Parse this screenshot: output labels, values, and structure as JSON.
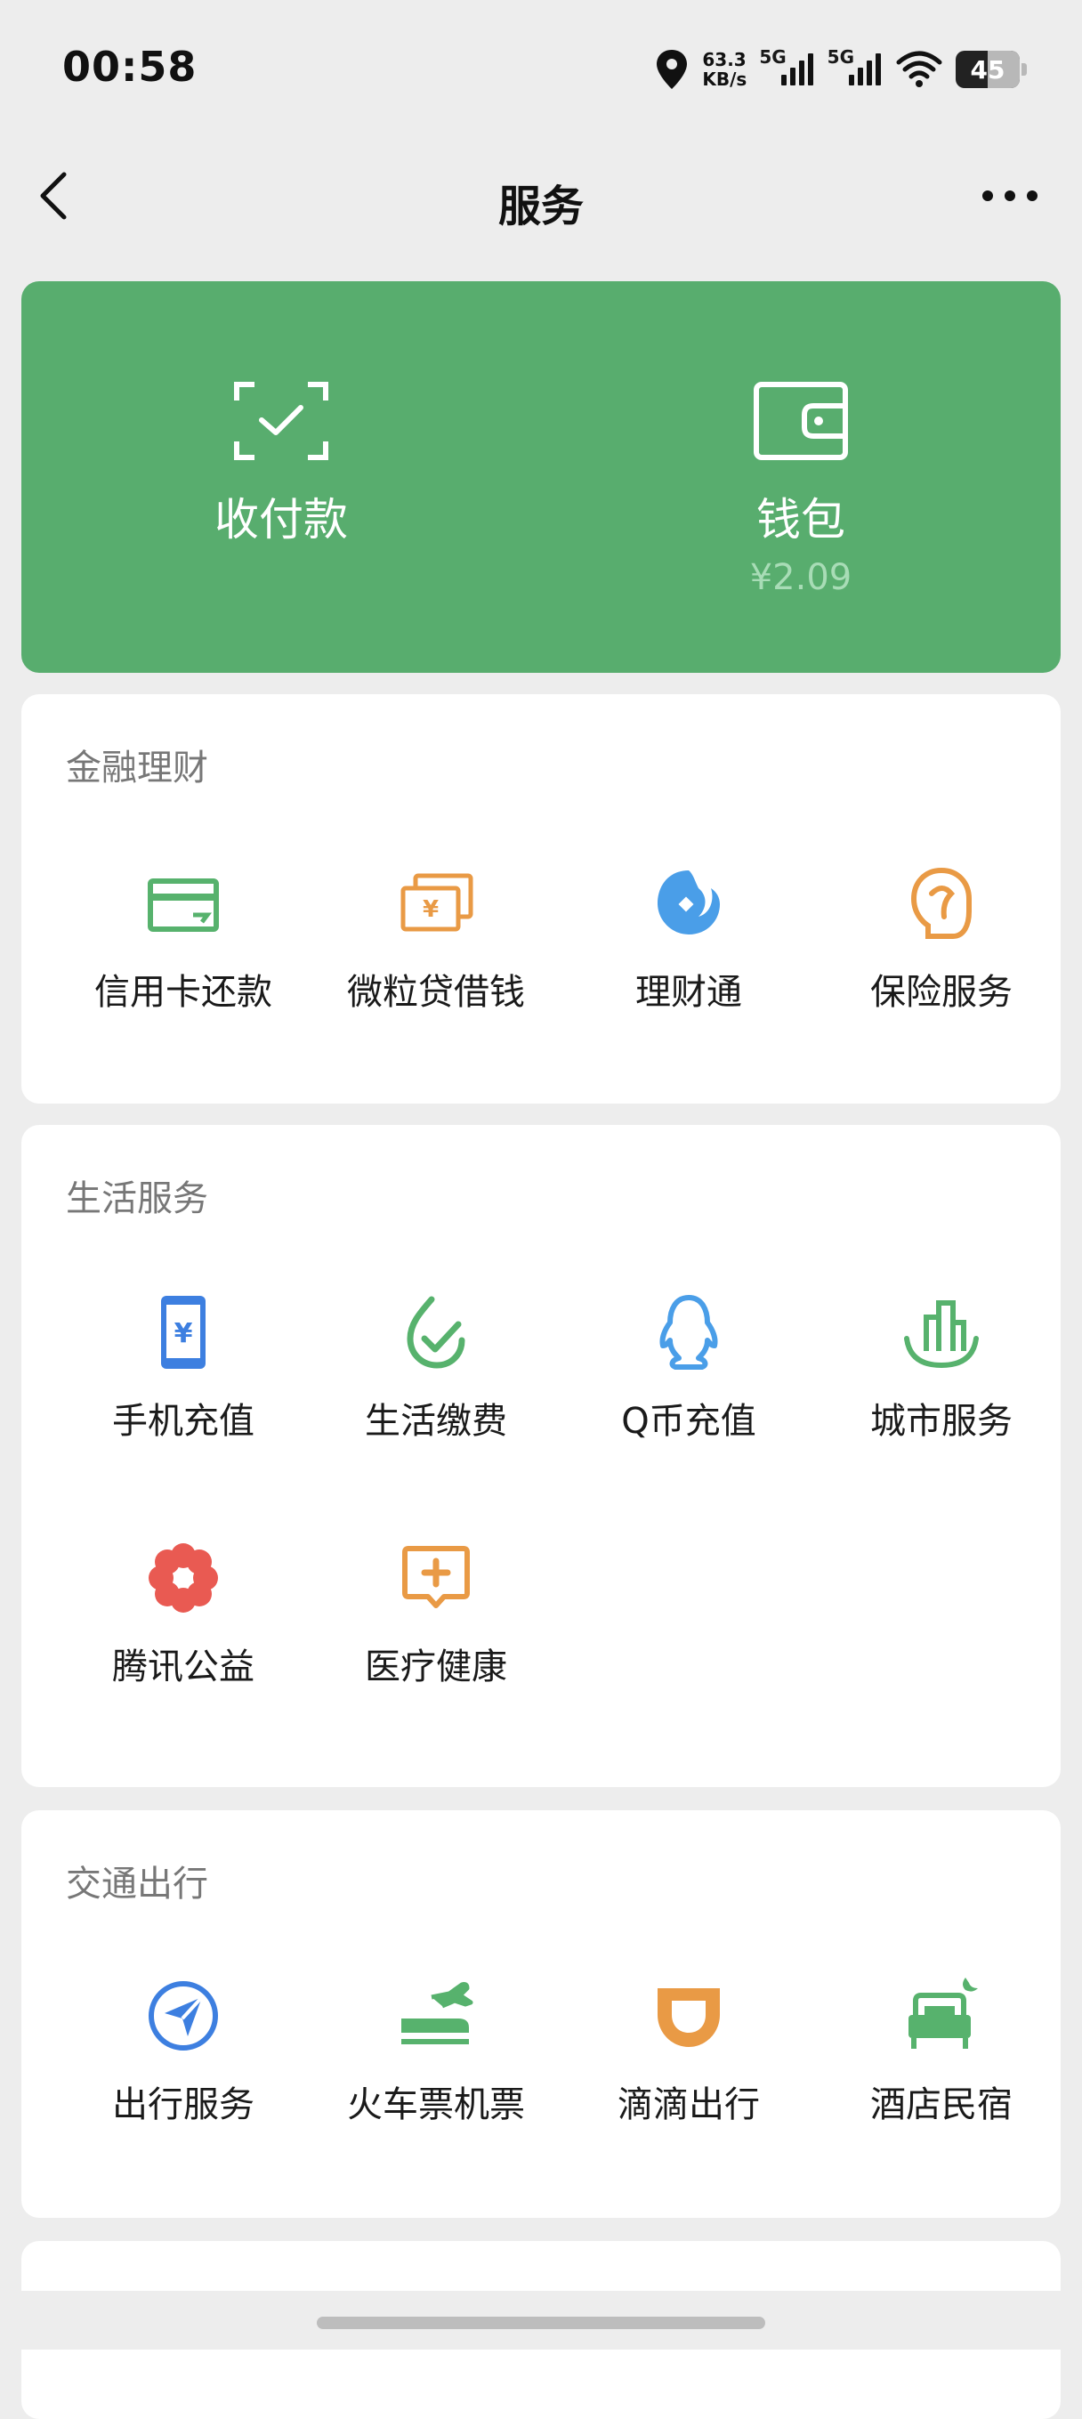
{
  "status": {
    "time": "00:58",
    "net_speed_value": "63.3",
    "net_speed_unit": "KB/s",
    "sig1": "5G",
    "sig2": "5G",
    "battery": "45"
  },
  "nav": {
    "title": "服务"
  },
  "hero": {
    "pay": {
      "label": "收付款"
    },
    "wallet": {
      "label": "钱包",
      "balance": "¥2.09"
    }
  },
  "sections": {
    "finance": {
      "title": "金融理财",
      "items": [
        {
          "label": "信用卡还款",
          "icon": "credit-card-icon",
          "color": "#57b26d"
        },
        {
          "label": "微粒贷借钱",
          "icon": "loan-cards-icon",
          "color": "#e99a45"
        },
        {
          "label": "理财通",
          "icon": "wealth-icon",
          "color": "#4a9ee8"
        },
        {
          "label": "保险服务",
          "icon": "insurance-icon",
          "color": "#e99a45"
        }
      ]
    },
    "life": {
      "title": "生活服务",
      "items": [
        {
          "label": "手机充值",
          "icon": "phone-recharge-icon",
          "color": "#3d7fe0"
        },
        {
          "label": "生活缴费",
          "icon": "utility-payment-icon",
          "color": "#57b26d"
        },
        {
          "label": "Q币充值",
          "icon": "qq-penguin-icon",
          "color": "#4a9ee8"
        },
        {
          "label": "城市服务",
          "icon": "city-service-icon",
          "color": "#57b26d"
        },
        {
          "label": "腾讯公益",
          "icon": "charity-flower-icon",
          "color": "#e95a52"
        },
        {
          "label": "医疗健康",
          "icon": "medical-icon",
          "color": "#e99a45"
        }
      ]
    },
    "travel": {
      "title": "交通出行",
      "items": [
        {
          "label": "出行服务",
          "icon": "navigation-icon",
          "color": "#3d7fe0"
        },
        {
          "label": "火车票机票",
          "icon": "train-plane-icon",
          "color": "#57b26d"
        },
        {
          "label": "滴滴出行",
          "icon": "didi-icon",
          "color": "#e99a45"
        },
        {
          "label": "酒店民宿",
          "icon": "hotel-bed-icon",
          "color": "#57b26d"
        }
      ]
    }
  }
}
